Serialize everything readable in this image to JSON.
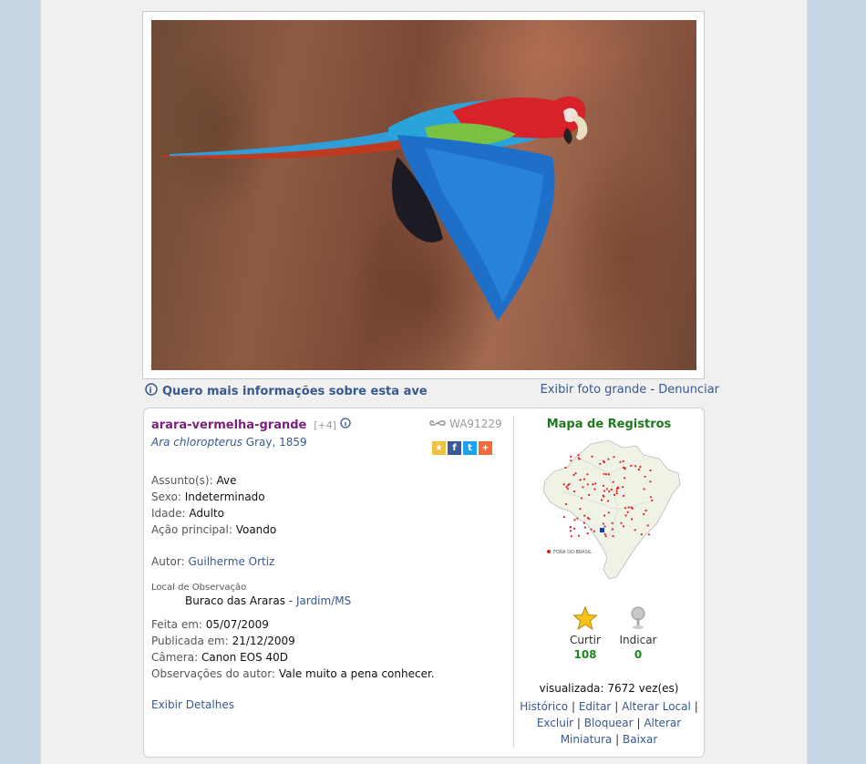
{
  "info_bar": {
    "more_info_label": "Quero mais informações sobre esta ave",
    "show_large_label": "Exibir foto grande",
    "separator": "-",
    "report_label": "Denunciar"
  },
  "species": {
    "common_name": "arara-vermelha-grande",
    "extra_count": "[+4]",
    "scientific_name": "Ara chloropterus",
    "author": "Gray, 1859",
    "record_code": "WA91229"
  },
  "share_icons": [
    "star-icon",
    "facebook-icon",
    "twitter-icon",
    "plus-icon"
  ],
  "details": {
    "subject": {
      "label": "Assunto(s):",
      "value": "Ave"
    },
    "sex": {
      "label": "Sexo:",
      "value": "Indeterminado"
    },
    "age": {
      "label": "Idade:",
      "value": "Adulto"
    },
    "action": {
      "label": "Ação principal:",
      "value": "Voando"
    },
    "author": {
      "label": "Autor:",
      "value": "Guilherme Ortiz"
    },
    "location_label": "Local de Observação",
    "location_place": "Buraco das Araras",
    "location_dash": "-",
    "location_city": "Jardim/MS",
    "taken": {
      "label": "Feita em:",
      "value": "05/07/2009"
    },
    "published": {
      "label": "Publicada em:",
      "value": "21/12/2009"
    },
    "camera": {
      "label": "Câmera:",
      "value": "Canon EOS 40D"
    },
    "notes": {
      "label": "Observações do autor:",
      "value": "Vale muito a pena conhecer."
    },
    "show_details_label": "Exibir Detalhes"
  },
  "map": {
    "title": "Mapa de Registros",
    "outside_label": "FORA DO BRASIL",
    "record_color": "#e02020"
  },
  "stats": {
    "like_label": "Curtir",
    "like_count": "108",
    "recommend_label": "Indicar",
    "recommend_count": "0",
    "views": "visualizada: 7672 vez(es)"
  },
  "actions": {
    "history": "Histórico",
    "edit": "Editar",
    "change_location": "Alterar Local",
    "delete": "Excluir",
    "block": "Bloquear",
    "change_thumbnail": "Alterar Miniatura",
    "download": "Baixar",
    "separator": "|"
  },
  "colors": {
    "link": "#36598f",
    "species_name": "#7a1f7a",
    "count_green": "#1d8a1d",
    "map_title": "#1d7a1d"
  }
}
